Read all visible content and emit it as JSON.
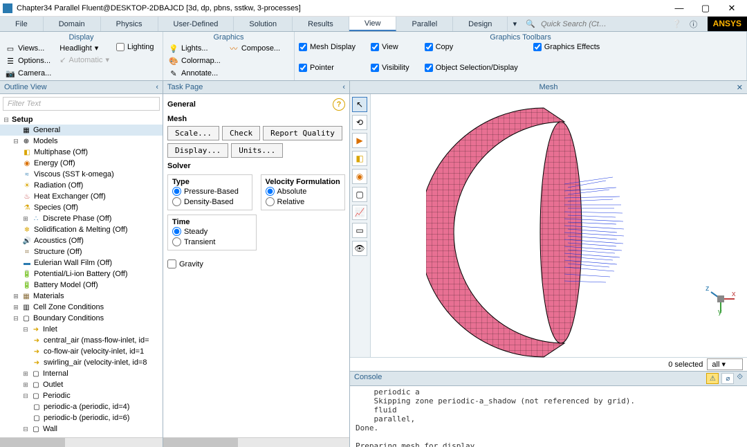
{
  "window": {
    "title": "Chapter34 Parallel Fluent@DESKTOP-2DBAJCD  [3d, dp, pbns, sstkw, 3-processes]"
  },
  "menu": {
    "items": [
      "File",
      "Domain",
      "Physics",
      "User-Defined",
      "Solution",
      "Results",
      "View",
      "Parallel",
      "Design"
    ],
    "active": "View",
    "search_placeholder": "Quick Search (Ct…",
    "logo": "ANSYS"
  },
  "ribbon": {
    "display": {
      "title": "Display",
      "views": "Views...",
      "headlight": "Headlight",
      "lighting": "Lighting",
      "options": "Options...",
      "automatic": "Automatic",
      "camera": "Camera..."
    },
    "graphics": {
      "title": "Graphics",
      "lights": "Lights...",
      "compose": "Compose...",
      "colormap": "Colormap...",
      "annotate": "Annotate..."
    },
    "toolbars": {
      "title": "Graphics Toolbars",
      "mesh_display": "Mesh Display",
      "view": "View",
      "copy": "Copy",
      "graphics_effects": "Graphics Effects",
      "pointer": "Pointer",
      "visibility": "Visibility",
      "object_selection": "Object Selection/Display"
    }
  },
  "outline": {
    "title": "Outline View",
    "filter_placeholder": "Filter Text",
    "nodes": {
      "setup": "Setup",
      "general": "General",
      "models": "Models",
      "multiphase": "Multiphase (Off)",
      "energy": "Energy (Off)",
      "viscous": "Viscous (SST k-omega)",
      "radiation": "Radiation (Off)",
      "heatex": "Heat Exchanger (Off)",
      "species": "Species (Off)",
      "dpm": "Discrete Phase (Off)",
      "solidif": "Solidification & Melting (Off)",
      "acoustics": "Acoustics (Off)",
      "structure": "Structure (Off)",
      "ewf": "Eulerian Wall Film (Off)",
      "battery": "Potential/Li-ion Battery (Off)",
      "batmodel": "Battery Model (Off)",
      "materials": "Materials",
      "cellzone": "Cell Zone Conditions",
      "bc": "Boundary Conditions",
      "inlet": "Inlet",
      "central": "central_air (mass-flow-inlet, id=",
      "coflow": "co-flow-air (velocity-inlet, id=1",
      "swirling": "swirling_air (velocity-inlet, id=8",
      "internal": "Internal",
      "outlet": "Outlet",
      "periodic": "Periodic",
      "pa": "periodic-a (periodic, id=4)",
      "pb": "periodic-b (periodic, id=6)",
      "wall": "Wall"
    }
  },
  "task": {
    "title": "Task Page",
    "section": "General",
    "mesh_label": "Mesh",
    "btn_scale": "Scale...",
    "btn_check": "Check",
    "btn_report": "Report Quality",
    "btn_display": "Display...",
    "btn_units": "Units...",
    "solver_label": "Solver",
    "type_label": "Type",
    "vel_label": "Velocity Formulation",
    "pressure": "Pressure-Based",
    "density": "Density-Based",
    "absolute": "Absolute",
    "relative": "Relative",
    "time_label": "Time",
    "steady": "Steady",
    "transient": "Transient",
    "gravity": "Gravity"
  },
  "gfx": {
    "title": "Mesh",
    "selected_text": "0 selected",
    "filter": "all"
  },
  "console": {
    "title": "Console",
    "text": "    periodic a\n    Skipping zone periodic-a_shadow (not referenced by grid).\n    fluid\n    parallel,\nDone.\n\nPreparing mesh for display...\nDone."
  },
  "colors": {
    "accent": "#3a7bbf",
    "panel": "#dce6ec",
    "mesh": "#e87093",
    "vectors": "#1030e0"
  }
}
